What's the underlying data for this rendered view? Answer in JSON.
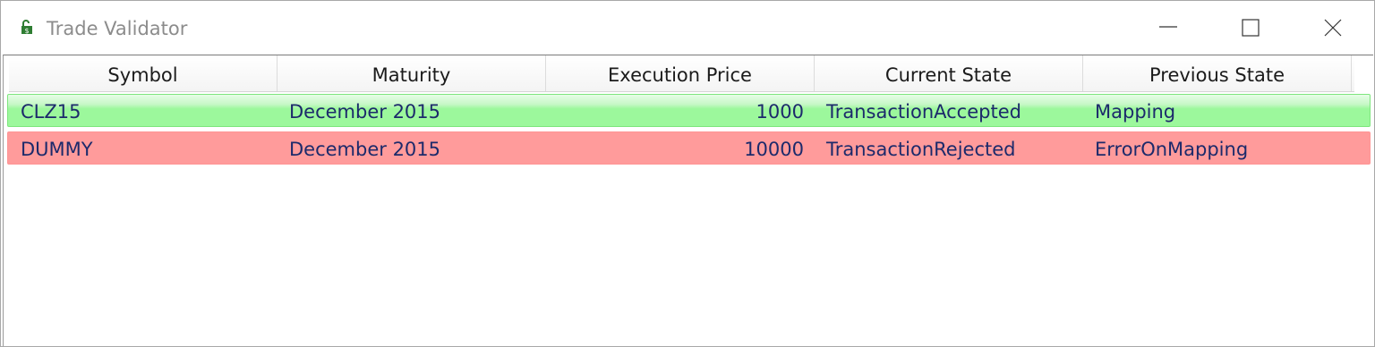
{
  "window": {
    "title": "Trade Validator",
    "icon": "lock-dollar-icon",
    "accent_colors": {
      "accepted_row": "#9cf89c",
      "rejected_row": "#ff9b9b",
      "cell_text": "#1c2a6b"
    }
  },
  "grid": {
    "columns": [
      "Symbol",
      "Maturity",
      "Execution Price",
      "Current State",
      "Previous State"
    ],
    "rows": [
      {
        "symbol": "CLZ15",
        "maturity": "December 2015",
        "execution_price": "1000",
        "current_state": "TransactionAccepted",
        "previous_state": "Mapping",
        "status": "accepted"
      },
      {
        "symbol": "DUMMY",
        "maturity": "December 2015",
        "execution_price": "10000",
        "current_state": "TransactionRejected",
        "previous_state": "ErrorOnMapping",
        "status": "rejected"
      }
    ]
  }
}
